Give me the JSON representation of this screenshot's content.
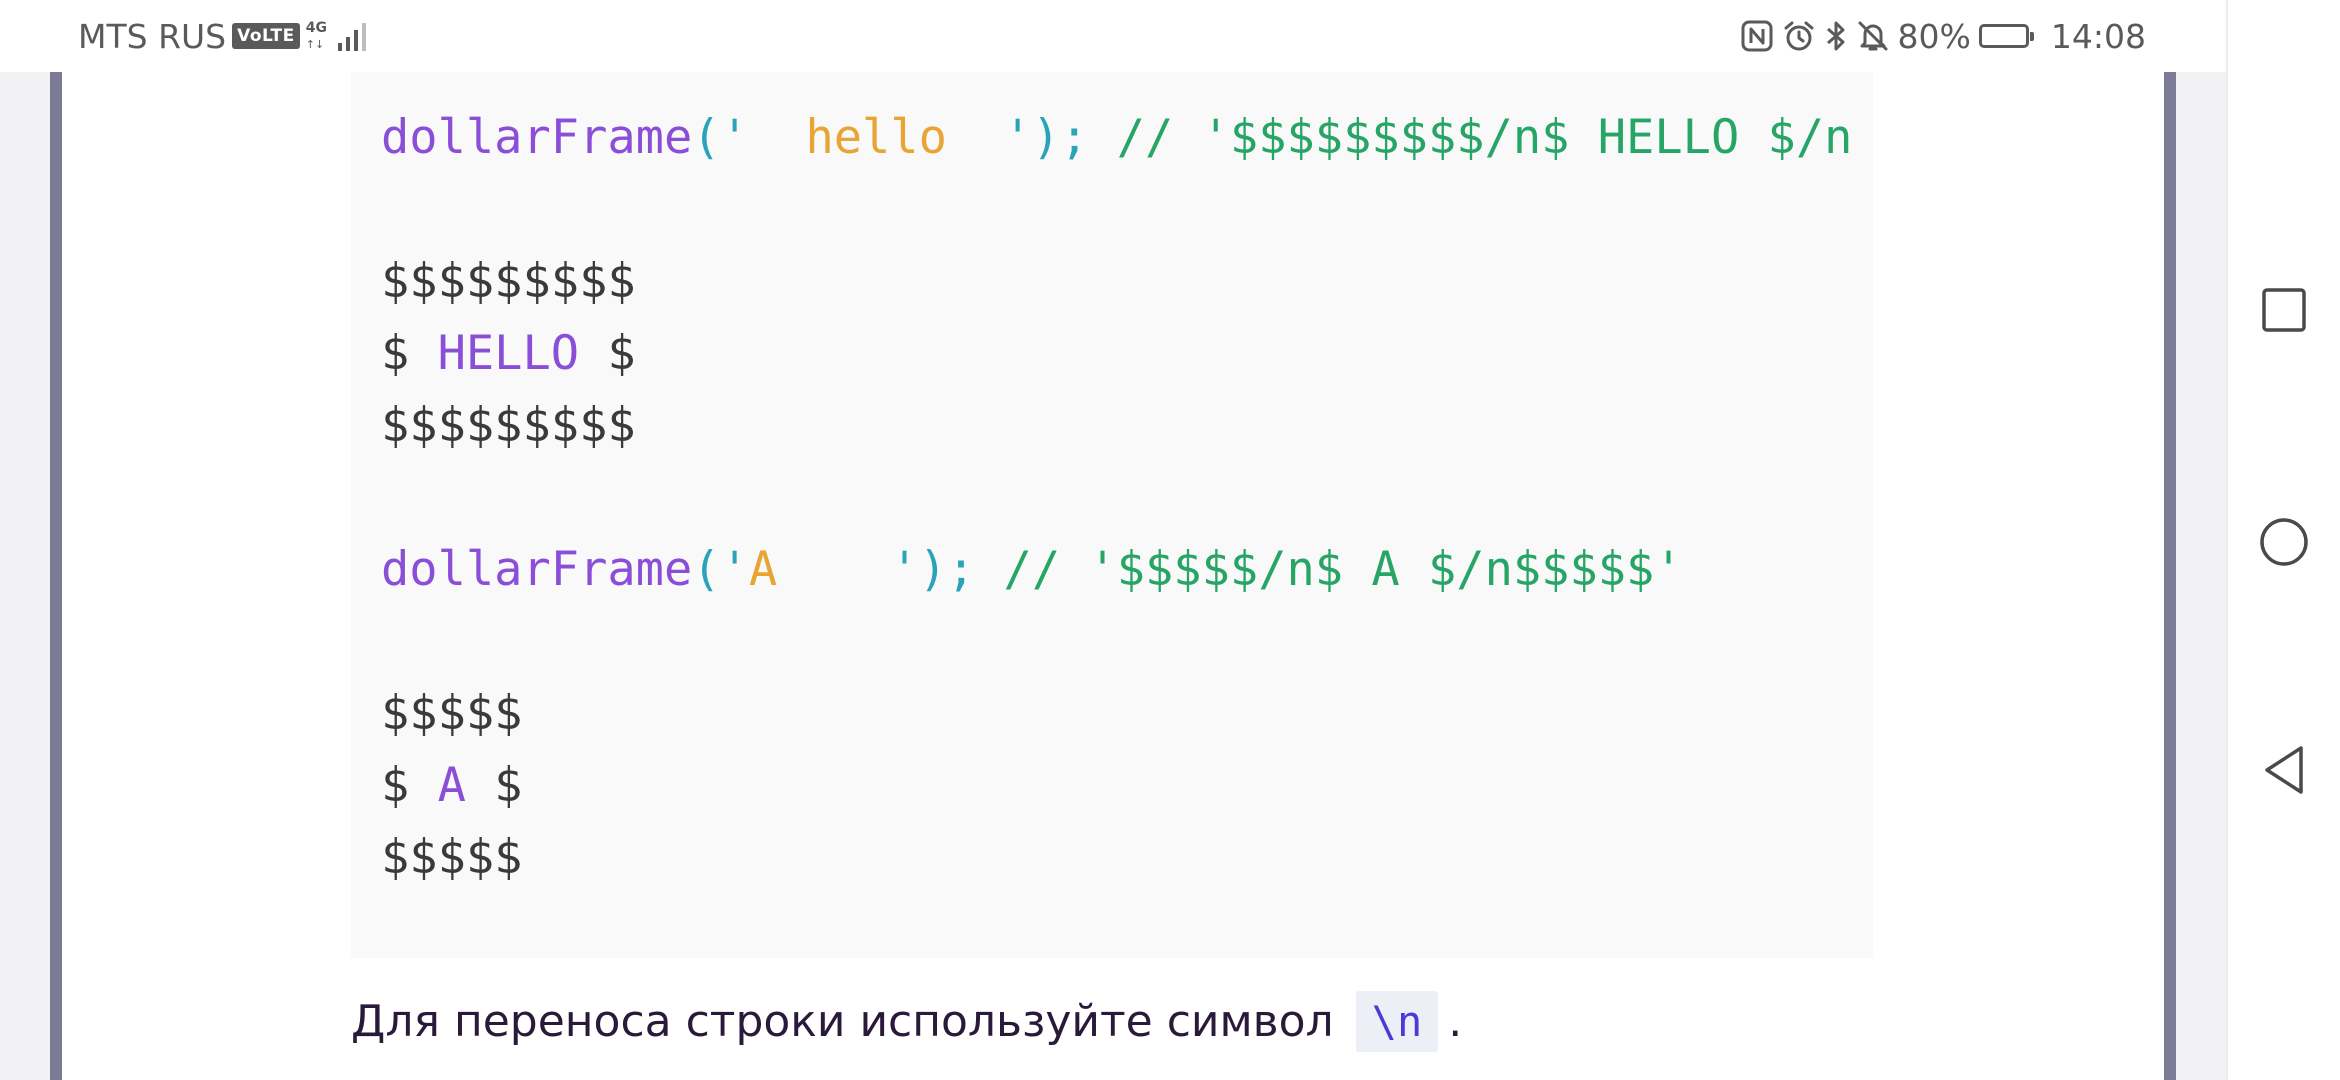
{
  "status_bar": {
    "carrier": "MTS RUS",
    "volte_badge": "VoLTE",
    "network_type": "4G",
    "network_arrows": "↑↓",
    "battery_percent": "80%",
    "battery_level": 0.8,
    "time": "14:08",
    "icons": [
      "signal-icon",
      "nfc-icon",
      "alarm-icon",
      "bluetooth-icon",
      "mute-icon",
      "battery-icon"
    ]
  },
  "code_lines": [
    {
      "fn": "dollarFrame",
      "open": "('",
      "arg": "  hello  ",
      "close": "');",
      "comment": " // '$$$$$$$$$/n$ HELLO $/n"
    },
    {
      "text": "$$$$$$$$$"
    },
    {
      "prefix": "$ ",
      "word": "HELLO",
      "suffix": " $"
    },
    {
      "text": "$$$$$$$$$"
    },
    {
      "fn": "dollarFrame",
      "open": "('",
      "arg": "A    ",
      "close": "');",
      "comment": " // '$$$$$/n$ A $/n$$$$$'"
    },
    {
      "text": "$$$$$"
    },
    {
      "prefix": "$ ",
      "word": "A",
      "suffix": " $"
    },
    {
      "text": "$$$$$"
    }
  ],
  "prose": {
    "text": "Для переноса строки используйте символ",
    "code": "\\n",
    "end": "."
  },
  "navbar": {
    "buttons": [
      "recent-apps-button",
      "home-button",
      "back-button"
    ]
  },
  "colors": {
    "function": "#8a4fd6",
    "punctuation": "#2aa3b8",
    "string": "#e8a533",
    "comment": "#27a566",
    "rail": "#7b7b96"
  }
}
